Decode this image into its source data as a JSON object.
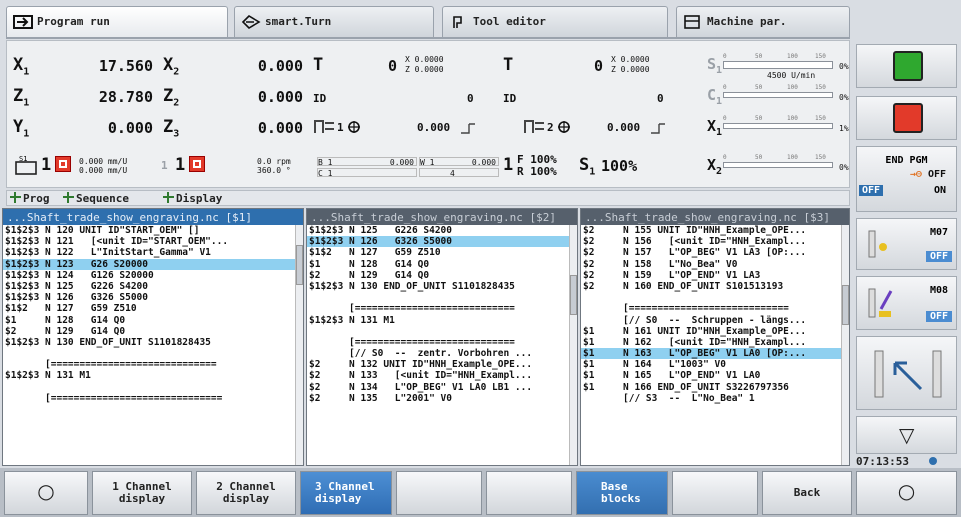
{
  "tabs": [
    "Program run",
    "smart.Turn",
    "Tool editor",
    "Machine par."
  ],
  "axes": {
    "x1": {
      "label": "X",
      "value": "17.560"
    },
    "z1": {
      "label": "Z",
      "value": "28.780"
    },
    "y1": {
      "label": "Y",
      "value": "0.000"
    },
    "x2": {
      "label": "X",
      "value": "0.000"
    },
    "z2": {
      "label": "Z",
      "value": "0.000"
    },
    "z3": {
      "label": "Z",
      "value": "0.000"
    }
  },
  "tools": {
    "t1": {
      "label": "T",
      "num": "0",
      "x": "X  0.0000",
      "z": "Z  0.0000"
    },
    "t2": {
      "label": "T",
      "num": "0",
      "x": "X  0.0000",
      "z": "Z  0.0000"
    },
    "id1": {
      "label": "ID",
      "value": "0"
    },
    "id2": {
      "label": "ID",
      "value": "0"
    },
    "spindle1": "0.000",
    "spindle2": "0.000",
    "spindle1_label": "1",
    "spindle2_label": "2"
  },
  "bottomrow": {
    "feed1": "0.000 mm/U",
    "feed2": "0.000 mm/U",
    "ch1": "1",
    "ch2": "1",
    "rpm": "0.0 rpm",
    "deg": "360.0 °",
    "b1": "B 1",
    "b1val": "0.000",
    "w1": "W 1",
    "w1val": "0.000",
    "c1": "C 1",
    "c4": "4",
    "chan1": "1",
    "f_override": "F 100%",
    "r_override": "R 100%",
    "s_label": "S",
    "s_sub": "1",
    "s_override": "100%"
  },
  "bars": [
    {
      "label": "S",
      "sub": "1",
      "text": "4500 U/min",
      "pct": "0%"
    },
    {
      "label": "C",
      "sub": "1",
      "text": "",
      "pct": "0%"
    },
    {
      "label": "X",
      "sub": "1",
      "text": "",
      "pct": "1%"
    },
    {
      "label": "X",
      "sub": "2",
      "text": "",
      "pct": "0%"
    }
  ],
  "bar_ticks": [
    "0",
    "50",
    "100",
    "150"
  ],
  "viewbar": {
    "prog": "Prog",
    "sequence": "Sequence",
    "display": "Display"
  },
  "channels": [
    {
      "title": "...Shaft_trade_show_engraving.nc [$1]",
      "active": true,
      "lines": [
        "$1$2$3 N 120 UNIT ID\"START_OEM\" []",
        "$1$2$3 N 121   [<unit ID=\"START_OEM\"...",
        "$1$2$3 N 122   L\"InitStart_Gamma\" V1",
        "$1$2$3 N 123   G26 S20000",
        "$1$2$3 N 124   G126 S20000",
        "$1$2$3 N 125   G226 S4200",
        "$1$2$3 N 126   G326 S5000",
        "$1$2   N 127   G59 Z510",
        "$1     N 128   G14 Q0",
        "$2     N 129   G14 Q0",
        "$1$2$3 N 130 END_OF_UNIT S1101828435",
        "",
        "       [=============================",
        "$1$2$3 N 131 M1",
        "",
        "       [=============================="
      ],
      "hl": 3
    },
    {
      "title": "...Shaft_trade_show_engraving.nc [$2]",
      "active": false,
      "lines": [
        "$1$2$3 N 125   G226 S4200",
        "$1$2$3 N 126   G326 S5000",
        "$1$2   N 127   G59 Z510",
        "$1     N 128   G14 Q0",
        "$2     N 129   G14 Q0",
        "$1$2$3 N 130 END_OF_UNIT S1101828435",
        "",
        "       [============================",
        "$1$2$3 N 131 M1",
        "",
        "       [============================",
        "       [// S0  --  zentr. Vorbohren ...",
        "$2     N 132 UNIT ID\"HNH_Example_OPE...",
        "$2     N 133   [<unit ID=\"HNH_Exampl...",
        "$2     N 134   L\"OP_BEG\" V1 LA0 LB1 ...",
        "$2     N 135   L\"2001\" V0"
      ],
      "hl": 1
    },
    {
      "title": "...Shaft_trade_show_engraving.nc [$3]",
      "active": false,
      "lines": [
        "$2     N 155 UNIT ID\"HNH_Example_OPE...",
        "$2     N 156   [<unit ID=\"HNH_Exampl...",
        "$2     N 157   L\"OP_BEG\" V1 LA3 [OP:...",
        "$2     N 158   L\"No_Bea\" V0",
        "$2     N 159   L\"OP_END\" V1 LA3",
        "$2     N 160 END_OF_UNIT S101513193",
        "",
        "       [============================",
        "       [// S0  --  Schruppen - längs...",
        "$1     N 161 UNIT ID\"HNH_Example_OPE...",
        "$1     N 162   [<unit ID=\"HNH_Exampl...",
        "$1     N 163   L\"OP_BEG\" V1 LA0 [OP:...",
        "$1     N 164   L\"1003\" V0",
        "$1     N 165   L\"OP_END\" V1 LA0",
        "$1     N 166 END_OF_UNIT S3226797356",
        "       [// S3  --  L\"No_Bea\" 1"
      ],
      "hl": 11
    }
  ],
  "right": {
    "end_pgm": "END PGM",
    "off": "OFF",
    "on": "ON",
    "off_sel": "OFF",
    "m07": "M07",
    "m07_state": "OFF",
    "m08": "M08",
    "m08_state": "OFF"
  },
  "clock": "07:13:53",
  "softkeys": [
    "",
    "1 Channel\ndisplay",
    "2 Channel\ndisplay",
    "3 Channel\ndisplay",
    "",
    "",
    "Base\nblocks",
    "",
    "Back",
    ""
  ],
  "colors": {
    "accent": "#2e6fae",
    "highlight": "#8fd0f0",
    "green": "#2fa82f",
    "red": "#e23a2a"
  }
}
